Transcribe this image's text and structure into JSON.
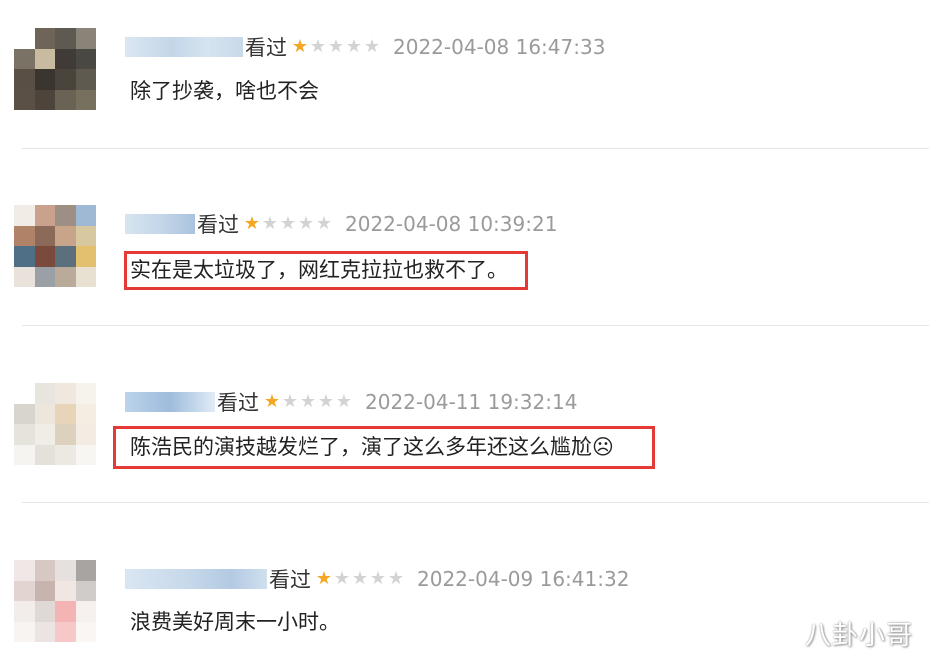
{
  "comments": [
    {
      "watched_label": "看过",
      "rating": 1,
      "rating_max": 5,
      "timestamp": "2022-04-08 16:47:33",
      "text": "除了抄袭，啥也不会",
      "highlighted": false
    },
    {
      "watched_label": "看过",
      "rating": 1,
      "rating_max": 5,
      "timestamp": "2022-04-08 10:39:21",
      "text": "实在是太垃圾了，网红克拉拉也救不了。",
      "highlighted": true
    },
    {
      "watched_label": "看过",
      "rating": 1,
      "rating_max": 5,
      "timestamp": "2022-04-11 19:32:14",
      "text": "陈浩民的演技越发烂了，演了这么多年还这么尴尬☹",
      "highlighted": true
    },
    {
      "watched_label": "看过",
      "rating": 1,
      "rating_max": 5,
      "timestamp": "2022-04-09 16:41:32",
      "text": "浪费美好周末一小时。",
      "highlighted": false
    }
  ],
  "watermark": "八卦小哥",
  "colors": {
    "star_filled": "#f5a623",
    "star_empty": "#d3d3d3",
    "highlight_border": "#e53935",
    "timestamp": "#9a9a9a",
    "username_blur": "#bcd4e9"
  }
}
